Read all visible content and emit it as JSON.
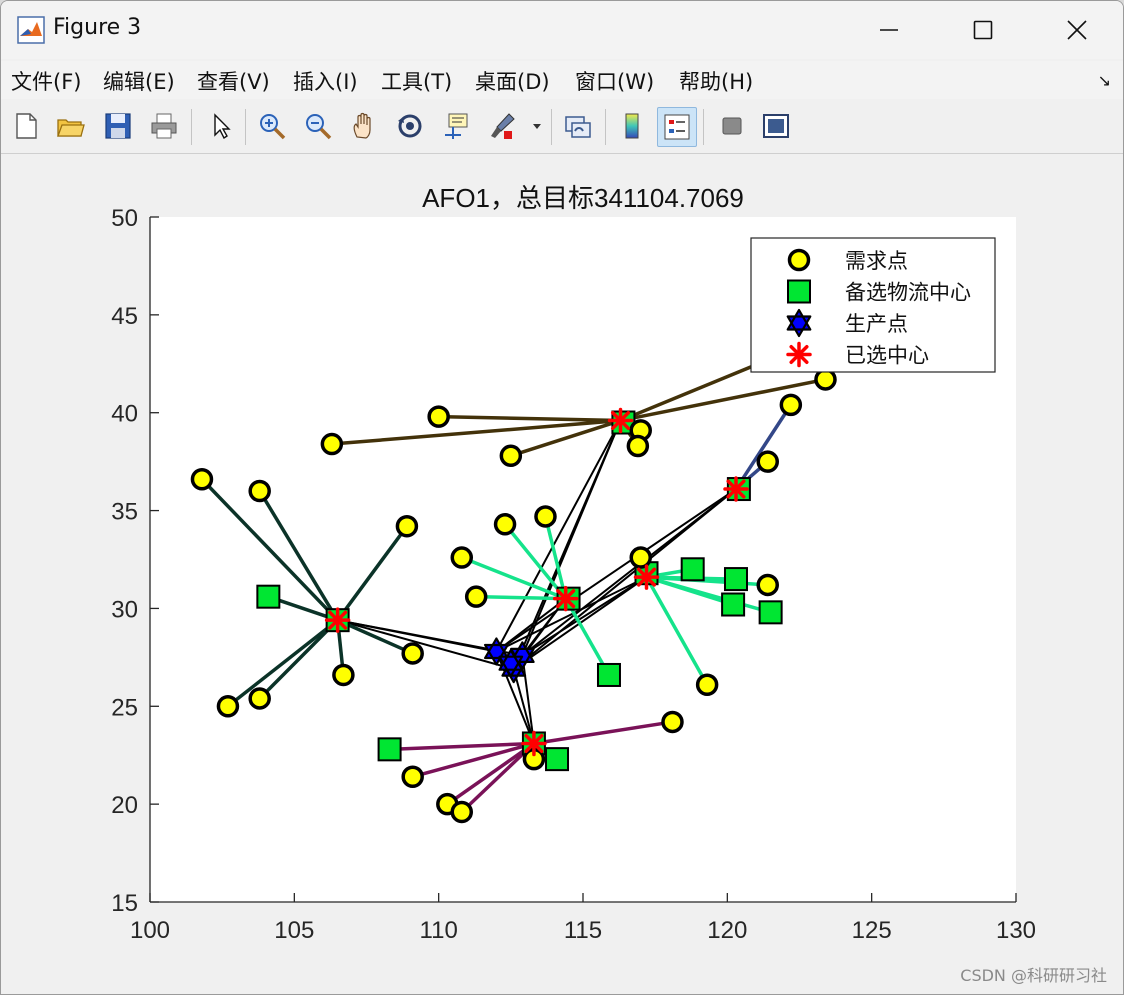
{
  "window": {
    "title": "Figure 3"
  },
  "menu": [
    {
      "label": "文件(F)",
      "key": "F"
    },
    {
      "label": "编辑(E)",
      "key": "E"
    },
    {
      "label": "查看(V)",
      "key": "V"
    },
    {
      "label": "插入(I)",
      "key": "I"
    },
    {
      "label": "工具(T)",
      "key": "T"
    },
    {
      "label": "桌面(D)",
      "key": "D"
    },
    {
      "label": "窗口(W)",
      "key": "W"
    },
    {
      "label": "帮助(H)",
      "key": "H"
    }
  ],
  "toolbar": [
    "new-figure-icon",
    "open-file-icon",
    "save-icon",
    "print-icon",
    "pointer-icon",
    "zoom-in-icon",
    "zoom-out-icon",
    "pan-icon",
    "rotate-3d-icon",
    "data-cursor-icon",
    "brush-icon",
    "link-plot-icon",
    "colorbar-icon",
    "legend-icon",
    "hide-plot-tools-icon",
    "show-plot-tools-icon"
  ],
  "watermark": "CSDN @科研研习社",
  "colors": {
    "demand": "#ffff00",
    "candidate": "#00e632",
    "producer": "#0000ff",
    "selected": "#ff0000",
    "cluster_A": "#43320a",
    "cluster_B": "#0b3328",
    "cluster_C": "#15e38b",
    "cluster_D": "#7a1258",
    "cluster_E": "#334788",
    "black": "#000000"
  },
  "chart_data": {
    "type": "scatter",
    "title": "AFO1，总目标341104.7069",
    "xlabel": "",
    "ylabel": "",
    "xlim": [
      100,
      130
    ],
    "ylim": [
      15,
      50
    ],
    "xticks": [
      100,
      105,
      110,
      115,
      120,
      125,
      130
    ],
    "yticks": [
      15,
      20,
      25,
      30,
      35,
      40,
      45,
      50
    ],
    "grid": false,
    "legend": {
      "placement": "top-right",
      "entries": [
        {
          "label": "需求点",
          "marker": "circle"
        },
        {
          "label": "备选物流中心",
          "marker": "square"
        },
        {
          "label": "生产点",
          "marker": "hexagram"
        },
        {
          "label": "已选中心",
          "marker": "asterisk"
        }
      ]
    },
    "demand_points": [
      [
        101.8,
        36.6
      ],
      [
        103.8,
        36.0
      ],
      [
        108.9,
        34.2
      ],
      [
        102.7,
        25.0
      ],
      [
        103.8,
        25.4
      ],
      [
        106.7,
        26.6
      ],
      [
        109.1,
        27.7
      ],
      [
        110.8,
        32.6
      ],
      [
        111.3,
        30.6
      ],
      [
        112.3,
        34.3
      ],
      [
        113.7,
        34.7
      ],
      [
        110.0,
        39.8
      ],
      [
        106.3,
        38.4
      ],
      [
        112.5,
        37.8
      ],
      [
        117.0,
        39.1
      ],
      [
        116.9,
        38.3
      ],
      [
        117.0,
        32.6
      ],
      [
        119.3,
        26.1
      ],
      [
        121.4,
        31.2
      ],
      [
        121.4,
        37.5
      ],
      [
        122.2,
        40.4
      ],
      [
        123.4,
        41.7
      ],
      [
        122.4,
        43.3
      ],
      [
        109.1,
        21.4
      ],
      [
        110.3,
        20.0
      ],
      [
        110.8,
        19.6
      ],
      [
        113.3,
        22.3
      ],
      [
        118.1,
        24.2
      ]
    ],
    "candidate_centers": [
      [
        104.1,
        30.6
      ],
      [
        106.5,
        29.4
      ],
      [
        108.3,
        22.8
      ],
      [
        114.1,
        22.3
      ],
      [
        115.9,
        26.6
      ],
      [
        114.5,
        30.5
      ],
      [
        118.8,
        32.0
      ],
      [
        120.3,
        31.5
      ],
      [
        120.2,
        30.2
      ],
      [
        121.5,
        29.8
      ],
      [
        117.2,
        31.8
      ],
      [
        116.4,
        39.5
      ],
      [
        120.4,
        36.1
      ],
      [
        113.3,
        23.1
      ]
    ],
    "producers": [
      [
        112.0,
        27.8
      ],
      [
        112.6,
        26.9
      ],
      [
        112.9,
        27.6
      ],
      [
        112.5,
        27.2
      ]
    ],
    "selected_centers": [
      [
        106.5,
        29.4
      ],
      [
        116.3,
        39.6
      ],
      [
        114.4,
        30.5
      ],
      [
        117.2,
        31.6
      ],
      [
        120.3,
        36.1
      ],
      [
        113.3,
        23.1
      ]
    ],
    "assignments": [
      {
        "center": [
          116.3,
          39.6
        ],
        "color_key": "cluster_A",
        "demands": [
          [
            110.0,
            39.8
          ],
          [
            106.3,
            38.4
          ],
          [
            112.5,
            37.8
          ],
          [
            117.0,
            39.1
          ],
          [
            116.9,
            38.3
          ],
          [
            123.4,
            41.7
          ],
          [
            122.4,
            43.3
          ]
        ]
      },
      {
        "center": [
          106.5,
          29.4
        ],
        "color_key": "cluster_B",
        "demands": [
          [
            101.8,
            36.6
          ],
          [
            103.8,
            36.0
          ],
          [
            108.9,
            34.2
          ],
          [
            102.7,
            25.0
          ],
          [
            103.8,
            25.4
          ],
          [
            106.7,
            26.6
          ],
          [
            109.1,
            27.7
          ],
          [
            104.1,
            30.6
          ]
        ]
      },
      {
        "center": [
          114.4,
          30.5
        ],
        "color_key": "cluster_C",
        "demands": [
          [
            110.8,
            32.6
          ],
          [
            111.3,
            30.6
          ],
          [
            112.3,
            34.3
          ],
          [
            113.7,
            34.7
          ],
          [
            115.9,
            26.6
          ]
        ]
      },
      {
        "center": [
          117.2,
          31.6
        ],
        "color_key": "cluster_C",
        "demands": [
          [
            117.0,
            32.6
          ],
          [
            119.3,
            26.1
          ],
          [
            121.4,
            31.2
          ],
          [
            118.8,
            32.0
          ],
          [
            120.3,
            31.5
          ],
          [
            120.2,
            30.2
          ],
          [
            121.5,
            29.8
          ]
        ]
      },
      {
        "center": [
          120.3,
          36.1
        ],
        "color_key": "cluster_E",
        "demands": [
          [
            121.4,
            37.5
          ],
          [
            122.2,
            40.4
          ]
        ]
      },
      {
        "center": [
          113.3,
          23.1
        ],
        "color_key": "cluster_D",
        "demands": [
          [
            108.3,
            22.8
          ],
          [
            109.1,
            21.4
          ],
          [
            110.3,
            20.0
          ],
          [
            110.8,
            19.6
          ],
          [
            113.3,
            22.3
          ],
          [
            114.1,
            22.3
          ],
          [
            118.1,
            24.2
          ]
        ]
      }
    ],
    "supply_links": [
      [
        [
          112.0,
          27.8
        ],
        [
          106.5,
          29.4
        ]
      ],
      [
        [
          112.6,
          26.9
        ],
        [
          106.5,
          29.4
        ]
      ],
      [
        [
          112.9,
          27.6
        ],
        [
          106.5,
          29.4
        ]
      ],
      [
        [
          112.0,
          27.8
        ],
        [
          116.3,
          39.6
        ]
      ],
      [
        [
          112.6,
          26.9
        ],
        [
          116.3,
          39.6
        ]
      ],
      [
        [
          112.9,
          27.6
        ],
        [
          116.3,
          39.6
        ]
      ],
      [
        [
          112.0,
          27.8
        ],
        [
          114.4,
          30.5
        ]
      ],
      [
        [
          112.6,
          26.9
        ],
        [
          114.4,
          30.5
        ]
      ],
      [
        [
          112.9,
          27.6
        ],
        [
          114.4,
          30.5
        ]
      ],
      [
        [
          112.0,
          27.8
        ],
        [
          117.2,
          31.6
        ]
      ],
      [
        [
          112.6,
          26.9
        ],
        [
          117.2,
          31.6
        ]
      ],
      [
        [
          112.9,
          27.6
        ],
        [
          117.2,
          31.6
        ]
      ],
      [
        [
          112.0,
          27.8
        ],
        [
          120.3,
          36.1
        ]
      ],
      [
        [
          112.6,
          26.9
        ],
        [
          120.3,
          36.1
        ]
      ],
      [
        [
          112.9,
          27.6
        ],
        [
          120.3,
          36.1
        ]
      ],
      [
        [
          112.0,
          27.8
        ],
        [
          113.3,
          23.1
        ]
      ],
      [
        [
          112.6,
          26.9
        ],
        [
          113.3,
          23.1
        ]
      ],
      [
        [
          112.9,
          27.6
        ],
        [
          113.3,
          23.1
        ]
      ]
    ]
  }
}
